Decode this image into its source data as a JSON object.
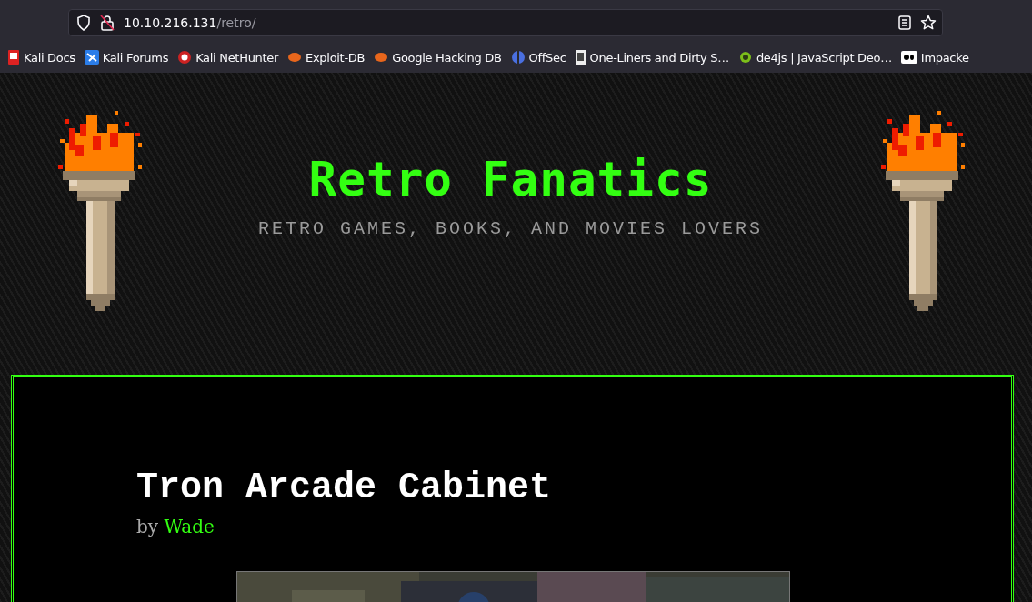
{
  "browser": {
    "address_host": "10.10.216.131",
    "address_path": "/retro/",
    "bookmarks": [
      {
        "label": "Kali Docs"
      },
      {
        "label": "Kali Forums"
      },
      {
        "label": "Kali NetHunter"
      },
      {
        "label": "Exploit-DB"
      },
      {
        "label": "Google Hacking DB"
      },
      {
        "label": "OffSec"
      },
      {
        "label": "One-Liners and Dirty S…"
      },
      {
        "label": "de4js | JavaScript Deo…"
      },
      {
        "label": "Impacke"
      }
    ]
  },
  "site": {
    "title": "Retro Fanatics",
    "tagline": "RETRO GAMES, BOOKS, AND MOVIES LOVERS"
  },
  "post": {
    "title": "Tron Arcade Cabinet",
    "by": "by",
    "author": "Wade"
  }
}
